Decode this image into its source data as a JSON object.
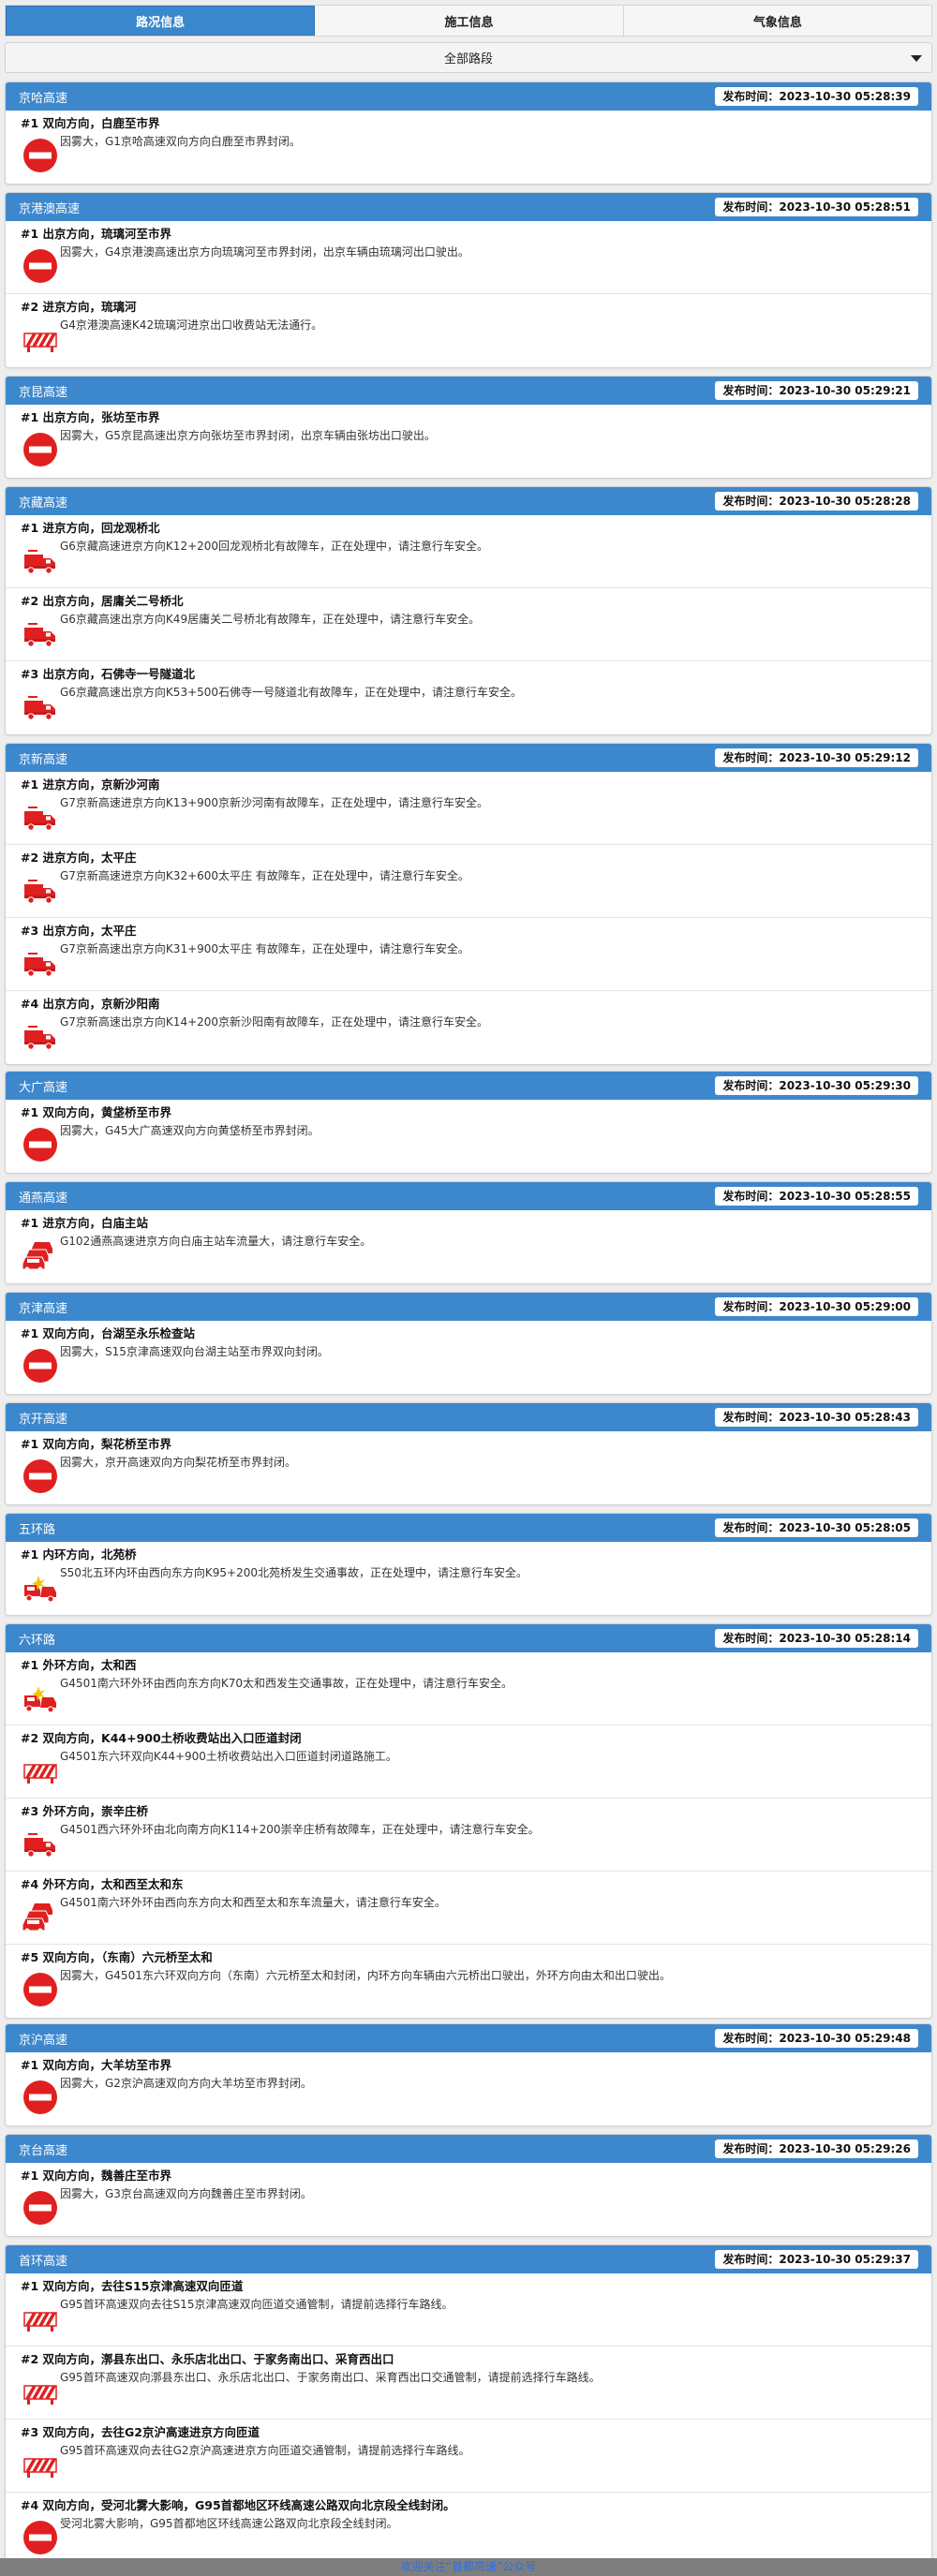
{
  "tabs": [
    "路况信息",
    "施工信息",
    "气象信息"
  ],
  "active_tab": 0,
  "filter": {
    "selected": "全部路段"
  },
  "publish_label": "发布时间：",
  "sections": [
    {
      "road": "京哈高速",
      "time": "2023-10-30 05:28:39",
      "items": [
        {
          "title": "#1 双向方向，白鹿至市界",
          "icon": "road-closed-icon",
          "desc": "因雾大，G1京哈高速双向方向白鹿至市界封闭。"
        }
      ]
    },
    {
      "road": "京港澳高速",
      "time": "2023-10-30 05:28:51",
      "items": [
        {
          "title": "#1 出京方向，琉璃河至市界",
          "icon": "road-closed-icon",
          "desc": "因雾大，G4京港澳高速出京方向琉璃河至市界封闭，出京车辆由琉璃河出口驶出。"
        },
        {
          "title": "#2 进京方向，琉璃河",
          "icon": "barrier-icon",
          "desc": "G4京港澳高速K42琉璃河进京出口收费站无法通行。"
        }
      ]
    },
    {
      "road": "京昆高速",
      "time": "2023-10-30 05:29:21",
      "items": [
        {
          "title": "#1 出京方向，张坊至市界",
          "icon": "road-closed-icon",
          "desc": "因雾大，G5京昆高速出京方向张坊至市界封闭，出京车辆由张坊出口驶出。"
        }
      ]
    },
    {
      "road": "京藏高速",
      "time": "2023-10-30 05:28:28",
      "items": [
        {
          "title": "#1 进京方向，回龙观桥北",
          "icon": "breakdown-truck-icon",
          "desc": "G6京藏高速进京方向K12+200回龙观桥北有故障车，正在处理中，请注意行车安全。"
        },
        {
          "title": "#2 出京方向，居庸关二号桥北",
          "icon": "breakdown-truck-icon",
          "desc": "G6京藏高速出京方向K49居庸关二号桥北有故障车，正在处理中，请注意行车安全。"
        },
        {
          "title": "#3 出京方向，石佛寺一号隧道北",
          "icon": "breakdown-truck-icon",
          "desc": "G6京藏高速出京方向K53+500石佛寺一号隧道北有故障车，正在处理中，请注意行车安全。"
        }
      ]
    },
    {
      "road": "京新高速",
      "time": "2023-10-30 05:29:12",
      "items": [
        {
          "title": "#1 进京方向，京新沙河南",
          "icon": "breakdown-truck-icon",
          "desc": "G7京新高速进京方向K13+900京新沙河南有故障车，正在处理中，请注意行车安全。"
        },
        {
          "title": "#2 进京方向，太平庄",
          "icon": "breakdown-truck-icon",
          "desc": "G7京新高速进京方向K32+600太平庄 有故障车，正在处理中，请注意行车安全。"
        },
        {
          "title": "#3 出京方向，太平庄",
          "icon": "breakdown-truck-icon",
          "desc": "G7京新高速出京方向K31+900太平庄 有故障车，正在处理中，请注意行车安全。"
        },
        {
          "title": "#4 出京方向，京新沙阳南",
          "icon": "breakdown-truck-icon",
          "desc": "G7京新高速出京方向K14+200京新沙阳南有故障车，正在处理中，请注意行车安全。"
        }
      ]
    },
    {
      "road": "大广高速",
      "time": "2023-10-30 05:29:30",
      "items": [
        {
          "title": "#1 双向方向，黄垡桥至市界",
          "icon": "road-closed-icon",
          "desc": "因雾大，G45大广高速双向方向黄垡桥至市界封闭。"
        }
      ]
    },
    {
      "road": "通燕高速",
      "time": "2023-10-30 05:28:55",
      "items": [
        {
          "title": "#1 进京方向，白庙主站",
          "icon": "congestion-icon",
          "desc": "G102通燕高速进京方向白庙主站车流量大，请注意行车安全。"
        }
      ]
    },
    {
      "road": "京津高速",
      "time": "2023-10-30 05:29:00",
      "items": [
        {
          "title": "#1 双向方向，台湖至永乐检查站",
          "icon": "road-closed-icon",
          "desc": "因雾大，S15京津高速双向台湖主站至市界双向封闭。"
        }
      ]
    },
    {
      "road": "京开高速",
      "time": "2023-10-30 05:28:43",
      "items": [
        {
          "title": "#1 双向方向，梨花桥至市界",
          "icon": "road-closed-icon",
          "desc": "因雾大，京开高速双向方向梨花桥至市界封闭。"
        }
      ]
    },
    {
      "road": "五环路",
      "time": "2023-10-30 05:28:05",
      "items": [
        {
          "title": "#1 内环方向，北苑桥",
          "icon": "accident-icon",
          "desc": "S50北五环内环由西向东方向K95+200北苑桥发生交通事故，正在处理中，请注意行车安全。"
        }
      ]
    },
    {
      "road": "六环路",
      "time": "2023-10-30 05:28:14",
      "items": [
        {
          "title": "#1 外环方向，太和西",
          "icon": "accident-icon",
          "desc": "G4501南六环外环由西向东方向K70太和西发生交通事故，正在处理中，请注意行车安全。"
        },
        {
          "title": "#2 双向方向，K44+900土桥收费站出入口匝道封闭",
          "icon": "barrier-icon",
          "desc": "G4501东六环双向K44+900土桥收费站出入口匝道封闭道路施工。"
        },
        {
          "title": "#3 外环方向，崇辛庄桥",
          "icon": "breakdown-truck-icon",
          "desc": "G4501西六环外环由北向南方向K114+200崇辛庄桥有故障车，正在处理中，请注意行车安全。"
        },
        {
          "title": "#4 外环方向，太和西至太和东",
          "icon": "congestion-icon",
          "desc": "G4501南六环外环由西向东方向太和西至太和东车流量大，请注意行车安全。"
        },
        {
          "title": "#5 双向方向，（东南）六元桥至太和",
          "icon": "road-closed-icon",
          "desc": "因雾大，G4501东六环双向方向（东南）六元桥至太和封闭，内环方向车辆由六元桥出口驶出，外环方向由太和出口驶出。"
        }
      ]
    },
    {
      "road": "京沪高速",
      "time": "2023-10-30 05:29:48",
      "items": [
        {
          "title": "#1 双向方向，大羊坊至市界",
          "icon": "road-closed-icon",
          "desc": "因雾大，G2京沪高速双向方向大羊坊至市界封闭。"
        }
      ]
    },
    {
      "road": "京台高速",
      "time": "2023-10-30 05:29:26",
      "items": [
        {
          "title": "#1 双向方向，魏善庄至市界",
          "icon": "road-closed-icon",
          "desc": "因雾大，G3京台高速双向方向魏善庄至市界封闭。"
        }
      ]
    },
    {
      "road": "首环高速",
      "time": "2023-10-30 05:29:37",
      "items": [
        {
          "title": "#1 双向方向，去往S15京津高速双向匝道",
          "icon": "barrier-icon",
          "desc": "G95首环高速双向去往S15京津高速双向匝道交通管制，请提前选择行车路线。"
        },
        {
          "title": "#2 双向方向，漷县东出口、永乐店北出口、于家务南出口、采育西出口",
          "icon": "barrier-icon",
          "desc": "G95首环高速双向漷县东出口、永乐店北出口、于家务南出口、采育西出口交通管制，请提前选择行车路线。"
        },
        {
          "title": "#3 双向方向，去往G2京沪高速进京方向匝道",
          "icon": "barrier-icon",
          "desc": "G95首环高速双向去往G2京沪高速进京方向匝道交通管制，请提前选择行车路线。"
        },
        {
          "title": "#4 双向方向，受河北雾大影响，G95首都地区环线高速公路双向北京段全线封闭。",
          "icon": "road-closed-icon",
          "desc": "受河北雾大影响，G95首都地区环线高速公路双向北京段全线封闭。"
        }
      ]
    }
  ],
  "footer": "欢迎关注“首都高速”公众号"
}
